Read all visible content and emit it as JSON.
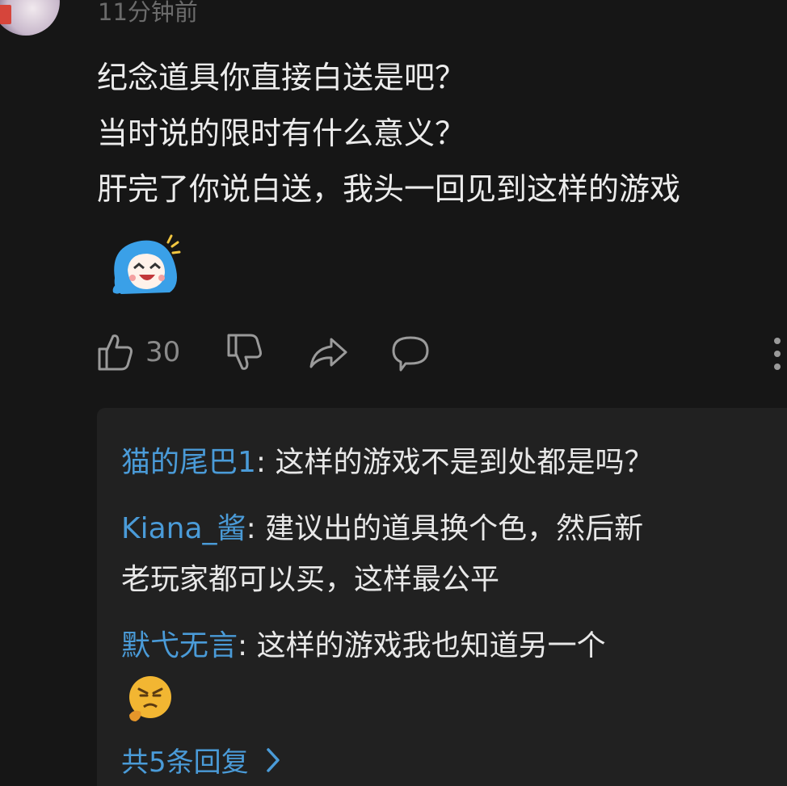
{
  "comment": {
    "time": "11分钟前",
    "lines": [
      "纪念道具你直接白送是吧？",
      "当时说的限时有什么意义？",
      "肝完了你说白送，我头一回见到这样的游戏"
    ],
    "likes": "30"
  },
  "replies": [
    {
      "user": "猫的尾巴1",
      "sep": ": ",
      "text": "这样的游戏不是到处都是吗？"
    },
    {
      "user": "Kiana_酱",
      "sep": ": ",
      "text": "建议出的道具换个色，然后新",
      "text2": "老玩家都可以买，这样最公平"
    },
    {
      "user": "默弋无言",
      "sep": ": ",
      "text": "这样的游戏我也知道另一个"
    }
  ],
  "more_replies": "共5条回复",
  "colors": {
    "accent": "#4a9bd8",
    "background": "#161616",
    "reply_bg": "#212121"
  }
}
